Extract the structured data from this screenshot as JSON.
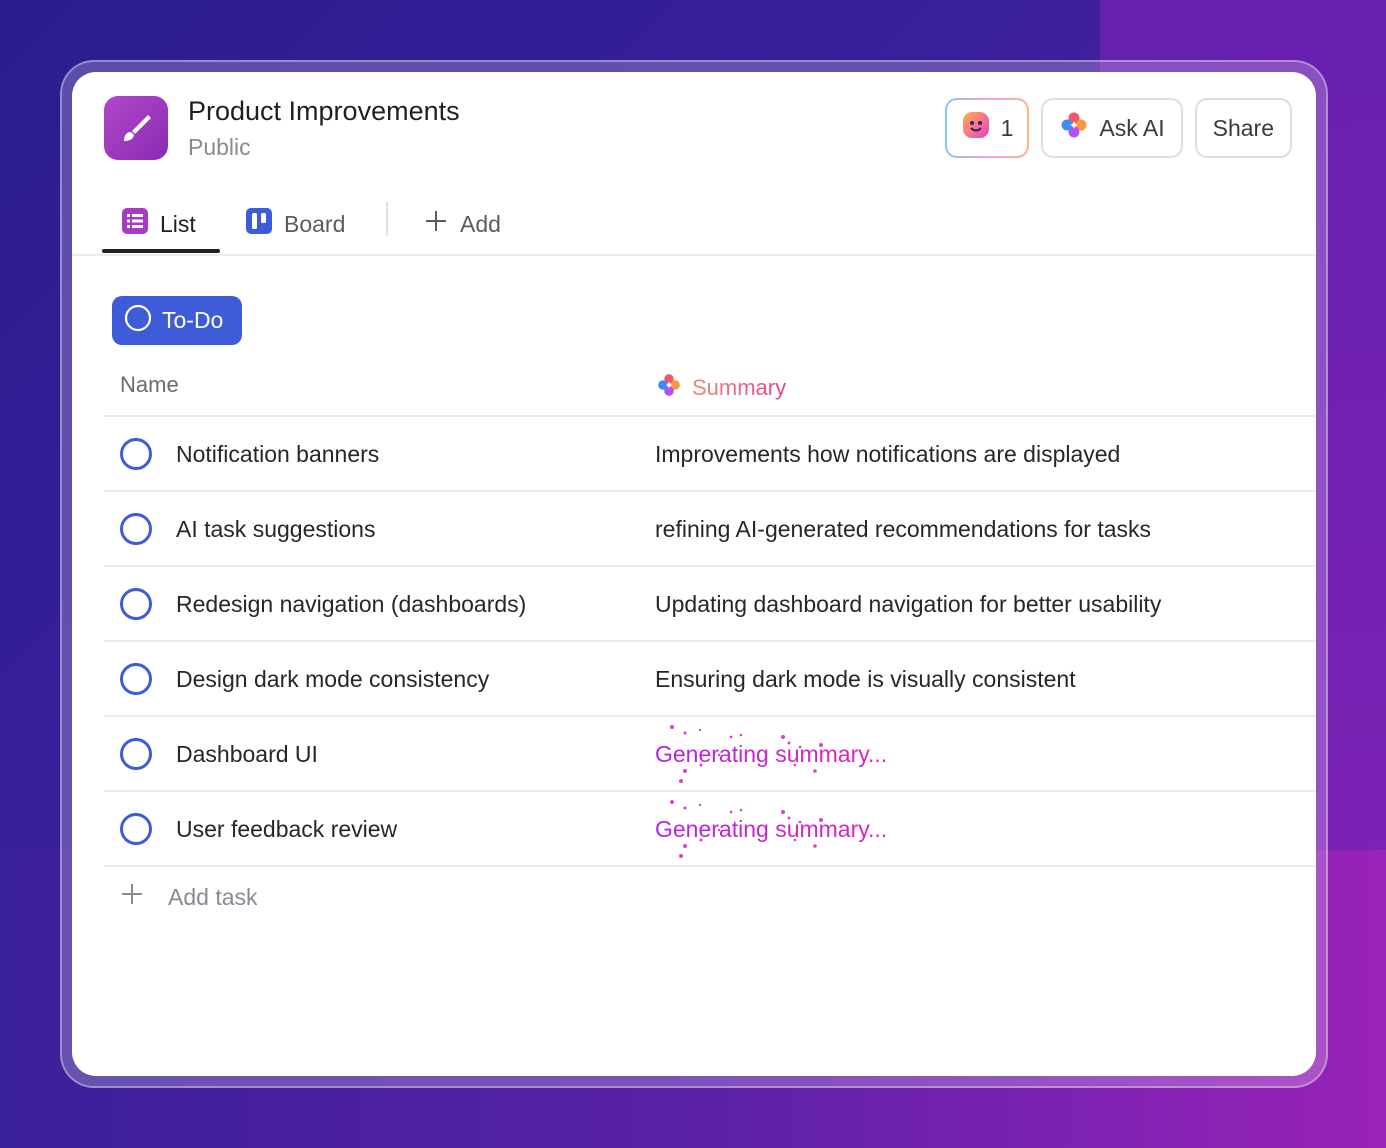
{
  "header": {
    "title": "Product Improvements",
    "subtitle": "Public",
    "ai_count_label": "1",
    "ask_ai_label": "Ask AI",
    "share_label": "Share"
  },
  "tabs": [
    {
      "label": "List",
      "icon": "list-icon",
      "active": true
    },
    {
      "label": "Board",
      "icon": "board-icon",
      "active": false
    },
    {
      "label": "Add",
      "icon": "plus-icon",
      "active": false
    }
  ],
  "group": {
    "status_label": "To-Do"
  },
  "columns": {
    "name": "Name",
    "summary": "Summary"
  },
  "tasks": [
    {
      "name": "Notification banners",
      "summary": "Improvements how notifications are displayed"
    },
    {
      "name": "AI task suggestions",
      "summary": "refining AI-generated recommendations for tasks"
    },
    {
      "name": "Redesign navigation (dashboards)",
      "summary": "Updating dashboard navigation for better usability"
    },
    {
      "name": "Design dark mode consistency",
      "summary": "Ensuring dark mode is visually consistent"
    },
    {
      "name": "Dashboard UI",
      "summary": "Generating summary..."
    },
    {
      "name": "User feedback review",
      "summary": "Generating summary..."
    }
  ],
  "add_task_label": "Add task",
  "colors": {
    "accent_blue": "#3e5bd8",
    "app_icon_purple": "#a03cc0",
    "generating_magenta": "#c424d8"
  }
}
